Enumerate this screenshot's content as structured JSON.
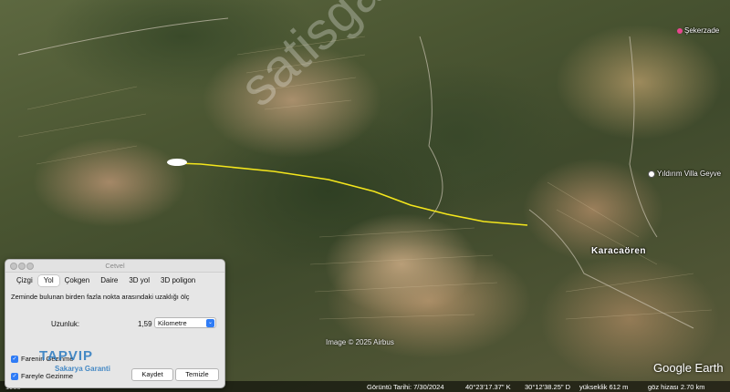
{
  "map": {
    "places": {
      "sekerzade": "Şekerzade",
      "yildirim_villa": "Yıldırım Villa Geyve",
      "karacaoren": "Karacaören"
    },
    "watermark": "satisgaranti",
    "image_credit": "Image © 2025 Airbus",
    "logo": "Google Earth",
    "path_color": "#f4e61c"
  },
  "status_bar": {
    "left": "1985",
    "date": "Görüntü Tarihi: 7/30/2024",
    "lat": "40°23'17.37\" K",
    "lon": "30°12'38.25\" D",
    "elevation": "yükseklik   612 m",
    "eye_alt": "göz hizası   2.70 km"
  },
  "dialog": {
    "title": "Cetvel",
    "tabs": [
      "Çizgi",
      "Yol",
      "Çokgen",
      "Daire",
      "3D yol",
      "3D poligon"
    ],
    "active_tab": "Yol",
    "description": "Zeminde bulunan birden fazla nokta arasındaki uzaklığı ölç",
    "length_label": "Uzunluk:",
    "length_value": "1,59",
    "unit": "Kilometre",
    "checkbox1": "Farenin Gezinme",
    "checkbox2": "Fareyle Gezinme",
    "save_button": "Kaydet",
    "clear_button": "Temizle"
  },
  "brand_overlay": {
    "line1": "TAPVIP",
    "line2": "Sakarya Garanti"
  }
}
